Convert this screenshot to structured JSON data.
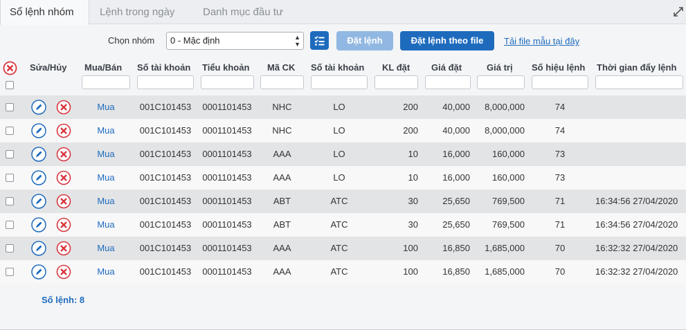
{
  "tabs": [
    {
      "label": "Sổ lệnh nhóm",
      "active": true
    },
    {
      "label": "Lệnh trong ngày",
      "active": false
    },
    {
      "label": "Danh mục đầu tư",
      "active": false
    }
  ],
  "toolbar": {
    "group_label": "Chọn nhóm",
    "group_selected": "0 - Mặc định",
    "list_button_icon": "checklist-icon",
    "place_order_label": "Đặt lệnh",
    "place_order_file_label": "Đặt lệnh theo file",
    "template_link": "Tải file mẫu tại đây"
  },
  "columns": {
    "edit_cancel": "Sửa/Hủy",
    "side": "Mua/Bán",
    "account": "Số tài khoản",
    "sub_account": "Tiểu khoản",
    "symbol": "Mã CK",
    "order_type": "Số tài khoản",
    "qty": "KL đặt",
    "price": "Giá đặt",
    "value": "Giá trị",
    "order_no": "Số hiệu lệnh",
    "push_time": "Thời gian đẩy lệnh"
  },
  "rows": [
    {
      "side": "Mua",
      "account": "001C101453",
      "sub_account": "0001101453",
      "symbol": "NHC",
      "order_type": "LO",
      "qty": "200",
      "price": "40,000",
      "value": "8,000,000",
      "order_no": "74",
      "push_time": ""
    },
    {
      "side": "Mua",
      "account": "001C101453",
      "sub_account": "0001101453",
      "symbol": "NHC",
      "order_type": "LO",
      "qty": "200",
      "price": "40,000",
      "value": "8,000,000",
      "order_no": "74",
      "push_time": ""
    },
    {
      "side": "Mua",
      "account": "001C101453",
      "sub_account": "0001101453",
      "symbol": "AAA",
      "order_type": "LO",
      "qty": "10",
      "price": "16,000",
      "value": "160,000",
      "order_no": "73",
      "push_time": ""
    },
    {
      "side": "Mua",
      "account": "001C101453",
      "sub_account": "0001101453",
      "symbol": "AAA",
      "order_type": "LO",
      "qty": "10",
      "price": "16,000",
      "value": "160,000",
      "order_no": "73",
      "push_time": ""
    },
    {
      "side": "Mua",
      "account": "001C101453",
      "sub_account": "0001101453",
      "symbol": "ABT",
      "order_type": "ATC",
      "qty": "30",
      "price": "25,650",
      "value": "769,500",
      "order_no": "71",
      "push_time": "16:34:56 27/04/2020"
    },
    {
      "side": "Mua",
      "account": "001C101453",
      "sub_account": "0001101453",
      "symbol": "ABT",
      "order_type": "ATC",
      "qty": "30",
      "price": "25,650",
      "value": "769,500",
      "order_no": "71",
      "push_time": "16:34:56 27/04/2020"
    },
    {
      "side": "Mua",
      "account": "001C101453",
      "sub_account": "0001101453",
      "symbol": "AAA",
      "order_type": "ATC",
      "qty": "100",
      "price": "16,850",
      "value": "1,685,000",
      "order_no": "70",
      "push_time": "16:32:32 27/04/2020"
    },
    {
      "side": "Mua",
      "account": "001C101453",
      "sub_account": "0001101453",
      "symbol": "AAA",
      "order_type": "ATC",
      "qty": "100",
      "price": "16,850",
      "value": "1,685,000",
      "order_no": "70",
      "push_time": "16:32:32 27/04/2020"
    }
  ],
  "footer": {
    "count_label": "Số lệnh: 8"
  },
  "icons": {
    "expand": "expand-icon",
    "edit": "pencil-icon",
    "cancel": "close-circle-icon"
  },
  "colors": {
    "accent": "#1e6bbd",
    "accent_disabled": "#91b8e2",
    "cancel_red": "#d9363e",
    "row_shaded": "#e3e4e6"
  }
}
